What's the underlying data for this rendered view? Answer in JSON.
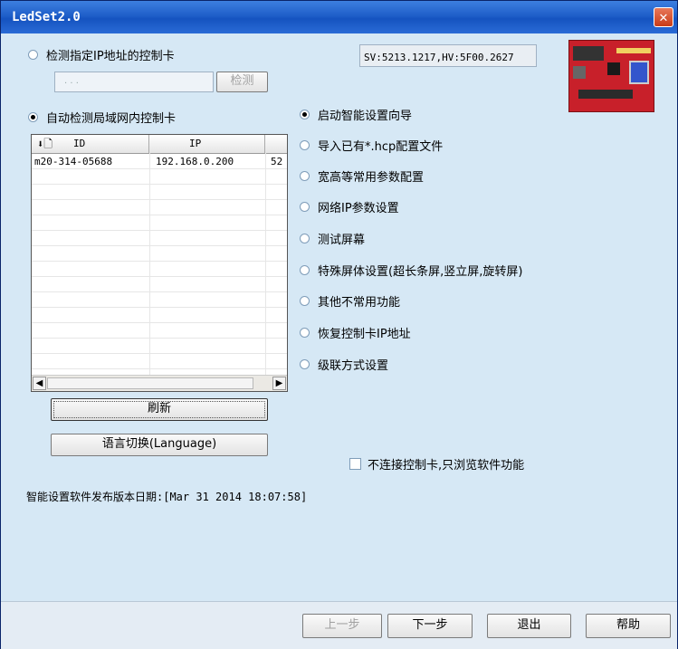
{
  "window": {
    "title": "LedSet2.0",
    "close_glyph": "✕"
  },
  "ip_detect": {
    "radio_label": "检测指定IP地址的控制卡",
    "ip_placeholder": ".        .        .",
    "detect_button": "检测"
  },
  "version_box": "SV:5213.1217,HV:5F00.2627",
  "auto_detect": {
    "radio_label": "自动检测局域网内控制卡"
  },
  "device_list": {
    "columns": [
      "ID",
      "IP",
      ""
    ],
    "rows": [
      {
        "id": "m20-314-05688",
        "ip": "192.168.0.200",
        "extra": "52"
      }
    ]
  },
  "refresh_button": "刷新",
  "language_button": "语言切换(Language)",
  "options": [
    {
      "label": "启动智能设置向导",
      "selected": true
    },
    {
      "label": "导入已有*.hcp配置文件",
      "selected": false
    },
    {
      "label": "宽高等常用参数配置",
      "selected": false
    },
    {
      "label": "网络IP参数设置",
      "selected": false
    },
    {
      "label": "测试屏幕",
      "selected": false
    },
    {
      "label": "特殊屏体设置(超长条屏,竖立屏,旋转屏)",
      "selected": false
    },
    {
      "label": "其他不常用功能",
      "selected": false
    },
    {
      "label": "恢复控制卡IP地址",
      "selected": false
    },
    {
      "label": "级联方式设置",
      "selected": false
    }
  ],
  "offline_checkbox": {
    "label": "不连接控制卡,只浏览软件功能",
    "checked": false
  },
  "release_date": "智能设置软件发布版本日期:[Mar 31 2014 18:07:58]",
  "footer": {
    "prev": "上一步",
    "next": "下一步",
    "exit": "退出",
    "help": "帮助"
  },
  "colors": {
    "accent": "#1f5fc9",
    "background": "#d6e8f5",
    "board": "#c8202a"
  }
}
